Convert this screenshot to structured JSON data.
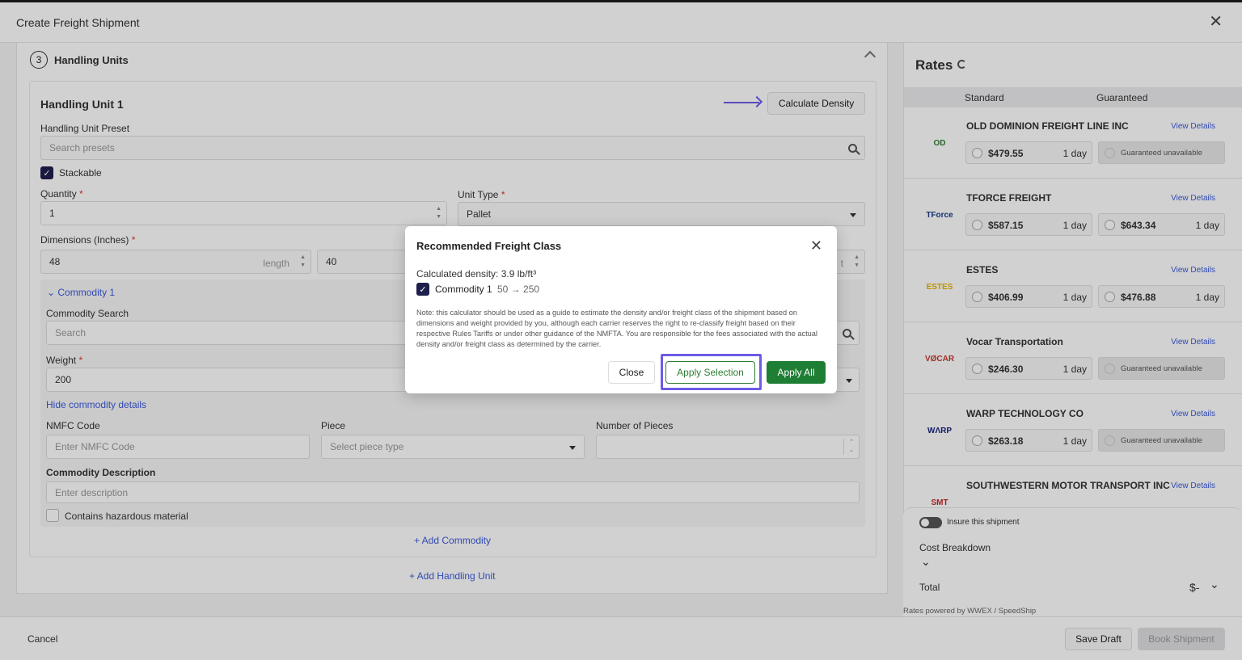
{
  "header": {
    "title": "Create Freight Shipment"
  },
  "handling_units": {
    "step_number": "3",
    "step_title": "Handling Units",
    "unit_title": "Handling Unit 1",
    "calculate_density_label": "Calculate Density",
    "preset_label": "Handling Unit Preset",
    "preset_placeholder": "Search presets",
    "stackable_label": "Stackable",
    "quantity_label": "Quantity",
    "quantity_value": "1",
    "unit_type_label": "Unit Type",
    "unit_type_value": "Pallet",
    "dimensions_label": "Dimensions (Inches)",
    "length_value": "48",
    "length_unit": "length",
    "width_value": "40",
    "height_unit_fragment": "t",
    "required_mark": "*",
    "add_handling_unit": "+ Add Handling Unit"
  },
  "commodity": {
    "title": "Commodity 1",
    "search_label": "Commodity Search",
    "search_placeholder": "Search",
    "weight_label": "Weight",
    "weight_value": "200",
    "hide_details": "Hide commodity details",
    "nmfc_label": "NMFC Code",
    "nmfc_placeholder": "Enter NMFC Code",
    "piece_label": "Piece",
    "piece_placeholder": "Select piece type",
    "pieces_label": "Number of Pieces",
    "description_label": "Commodity Description",
    "description_placeholder": "Enter description",
    "hazmat_label": "Contains hazardous material",
    "add_commodity": "+ Add Commodity"
  },
  "modal": {
    "title": "Recommended Freight Class",
    "density": "Calculated density: 3.9 lb/ft³",
    "commodity_label": "Commodity 1",
    "class_change": "50 → 250",
    "note": "Note: this calculator should be used as a guide to estimate the density and/or freight class of the shipment based on dimensions and weight provided by you, although each carrier reserves the right to re-classify freight based on their respective Rules Tariffs or under other guidance of the NMFTA. You are responsible for the fees associated with the actual density and/or freight class as determined by the carrier.",
    "close_label": "Close",
    "apply_selection_label": "Apply Selection",
    "apply_all_label": "Apply All"
  },
  "rates": {
    "title": "Rates",
    "col_standard": "Standard",
    "col_guaranteed": "Guaranteed",
    "view_details": "View Details",
    "carriers": [
      {
        "name": "OLD DOMINION FREIGHT LINE INC",
        "logo": "OD",
        "logo_color": "#2e7d32",
        "standard_price": "$479.55",
        "standard_days": "1 day",
        "guaranteed_price": "",
        "guaranteed_days": "",
        "guaranteed_text": "Guaranteed unavailable"
      },
      {
        "name": "TFORCE FREIGHT",
        "logo": "TForce",
        "logo_color": "#1a3a8a",
        "standard_price": "$587.15",
        "standard_days": "1 day",
        "guaranteed_price": "$643.34",
        "guaranteed_days": "1 day",
        "guaranteed_text": ""
      },
      {
        "name": "ESTES",
        "logo": "ESTES",
        "logo_color": "#e5b400",
        "standard_price": "$406.99",
        "standard_days": "1 day",
        "guaranteed_price": "$476.88",
        "guaranteed_days": "1 day",
        "guaranteed_text": ""
      },
      {
        "name": "Vocar Transportation",
        "logo": "VØCAR",
        "logo_color": "#c0392b",
        "standard_price": "$246.30",
        "standard_days": "1 day",
        "guaranteed_price": "",
        "guaranteed_days": "",
        "guaranteed_text": "Guaranteed unavailable"
      },
      {
        "name": "WARP TECHNOLOGY CO",
        "logo": "WΛRP",
        "logo_color": "#1a237e",
        "standard_price": "$263.18",
        "standard_days": "1 day",
        "guaranteed_price": "",
        "guaranteed_days": "",
        "guaranteed_text": "Guaranteed unavailable"
      },
      {
        "name": "SOUTHWESTERN MOTOR TRANSPORT INC",
        "logo": "SMT",
        "logo_color": "#c62828",
        "standard_price": "",
        "standard_days": "",
        "guaranteed_price": "",
        "guaranteed_days": "",
        "guaranteed_text": ""
      }
    ]
  },
  "summary": {
    "insure_label": "Insure this shipment",
    "cost_breakdown_label": "Cost Breakdown",
    "total_label": "Total",
    "total_value": "$-",
    "powered_by": "Rates powered by WWEX / SpeedShip"
  },
  "footer": {
    "cancel_label": "Cancel",
    "save_draft_label": "Save Draft",
    "book_label": "Book Shipment"
  }
}
